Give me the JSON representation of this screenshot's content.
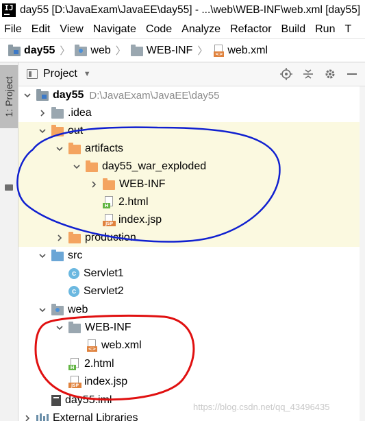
{
  "window": {
    "title": "day55 [D:\\JavaExam\\JavaEE\\day55] - ...\\web\\WEB-INF\\web.xml [day55]"
  },
  "menu": [
    "File",
    "Edit",
    "View",
    "Navigate",
    "Code",
    "Analyze",
    "Refactor",
    "Build",
    "Run",
    "T"
  ],
  "breadcrumb": {
    "project": "day55",
    "folder1": "web",
    "folder2": "WEB-INF",
    "file": "web.xml"
  },
  "sidebar": {
    "tab_label": "1: Project"
  },
  "panel": {
    "title": "Project"
  },
  "tree": {
    "root": {
      "name": "day55",
      "path": "D:\\JavaExam\\JavaEE\\day55"
    },
    "idea": ".idea",
    "out": "out",
    "artifacts": "artifacts",
    "exploded": "day55_war_exploded",
    "out_webinf": "WEB-INF",
    "out_html": "2.html",
    "out_jsp": "index.jsp",
    "production": "production",
    "src": "src",
    "servlet1": "Servlet1",
    "servlet2": "Servlet2",
    "web": "web",
    "web_webinf": "WEB-INF",
    "web_xml": "web.xml",
    "web_html": "2.html",
    "web_jsp": "index.jsp",
    "iml": "day55.iml",
    "libs": "External Libraries"
  },
  "icons": {
    "app": "intellij-icon",
    "module": "module-folder-icon",
    "folder": "folder-icon",
    "class": "java-class-icon",
    "html": "html-file-icon",
    "jsp": "jsp-file-icon",
    "xml": "xml-file-icon"
  },
  "colors": {
    "highlight_row": "#fbf9e0",
    "annotation_blue": "#1020d0",
    "annotation_red": "#e01010"
  },
  "watermark": "https://blog.csdn.net/qq_43496435"
}
